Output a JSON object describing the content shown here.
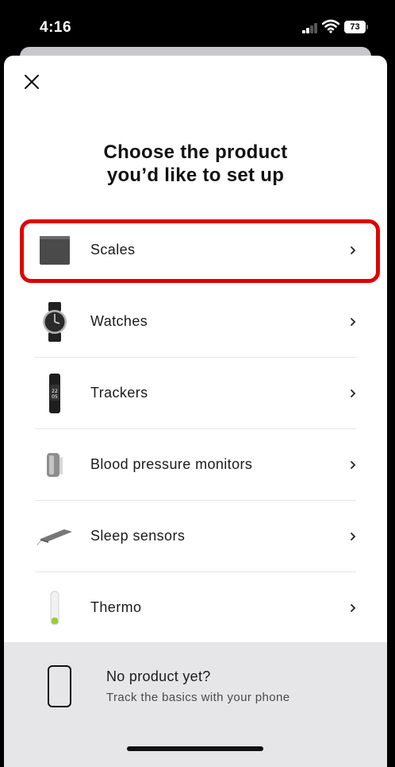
{
  "status_bar": {
    "time": "4:16",
    "battery": "73"
  },
  "title": {
    "line1": "Choose the product",
    "line2": "you’d like to set up"
  },
  "products": [
    {
      "label": "Scales",
      "icon": "scale-icon"
    },
    {
      "label": "Watches",
      "icon": "watch-icon"
    },
    {
      "label": "Trackers",
      "icon": "tracker-icon"
    },
    {
      "label": "Blood pressure monitors",
      "icon": "blood-pressure-monitor-icon"
    },
    {
      "label": "Sleep sensors",
      "icon": "sleep-sensor-icon"
    },
    {
      "label": "Thermo",
      "icon": "thermometer-icon"
    }
  ],
  "footer": {
    "title": "No product yet?",
    "subtitle": "Track the basics with your phone"
  },
  "colors": {
    "highlight": "#e00000",
    "footer_bg": "#e6e6e8"
  }
}
